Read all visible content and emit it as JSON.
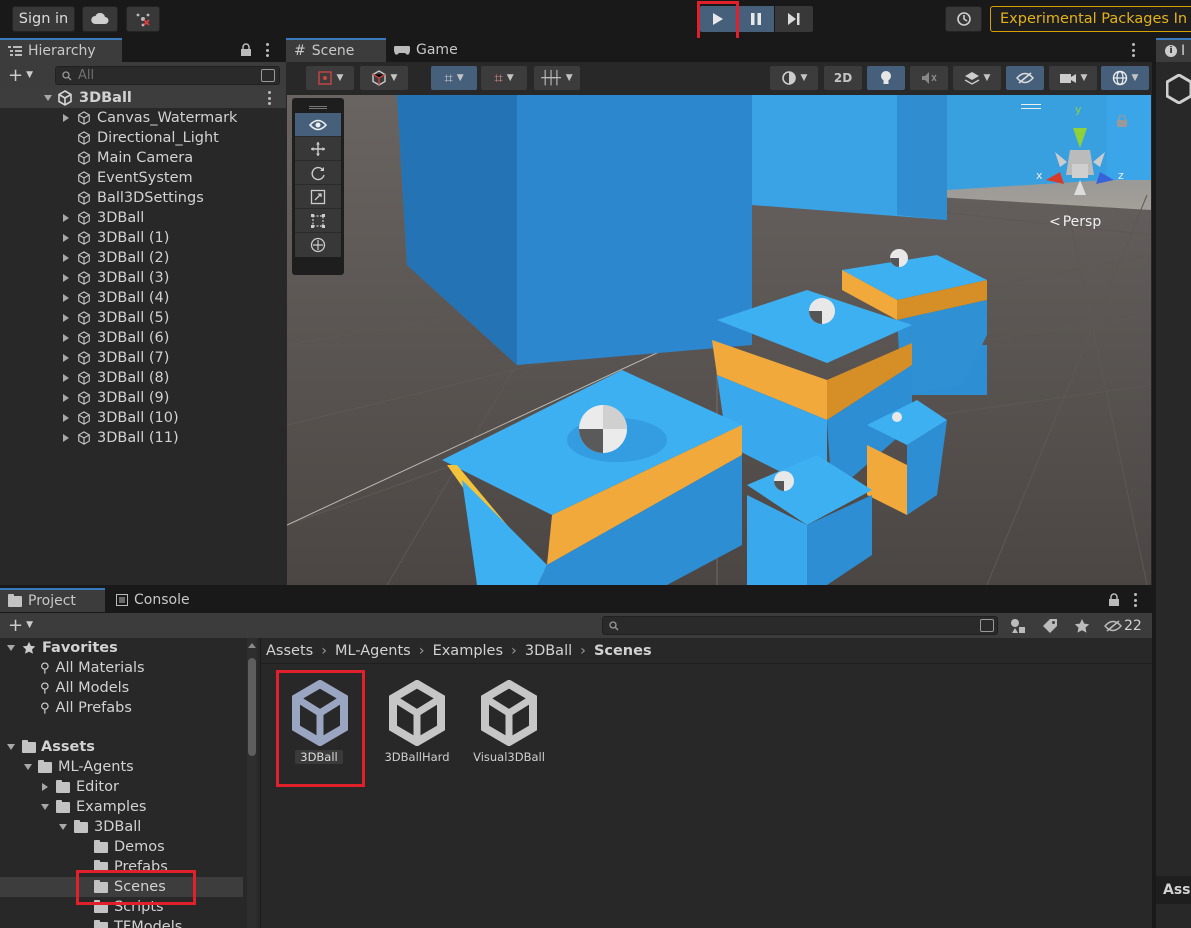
{
  "toolbar": {
    "sign_in": "Sign in",
    "experimental": "Experimental Packages In U"
  },
  "hierarchy": {
    "tab": "Hierarchy",
    "search_placeholder": "All",
    "root": "3DBall",
    "items": [
      {
        "label": "Canvas_Watermark",
        "expandable": true
      },
      {
        "label": "Directional_Light",
        "expandable": false
      },
      {
        "label": "Main Camera",
        "expandable": false
      },
      {
        "label": "EventSystem",
        "expandable": false
      },
      {
        "label": "Ball3DSettings",
        "expandable": false
      },
      {
        "label": "3DBall",
        "expandable": true
      },
      {
        "label": "3DBall (1)",
        "expandable": true
      },
      {
        "label": "3DBall (2)",
        "expandable": true
      },
      {
        "label": "3DBall (3)",
        "expandable": true
      },
      {
        "label": "3DBall (4)",
        "expandable": true
      },
      {
        "label": "3DBall (5)",
        "expandable": true
      },
      {
        "label": "3DBall (6)",
        "expandable": true
      },
      {
        "label": "3DBall (7)",
        "expandable": true
      },
      {
        "label": "3DBall (8)",
        "expandable": true
      },
      {
        "label": "3DBall (9)",
        "expandable": true
      },
      {
        "label": "3DBall (10)",
        "expandable": true
      },
      {
        "label": "3DBall (11)",
        "expandable": true
      }
    ]
  },
  "scene": {
    "tab_scene": "Scene",
    "tab_game": "Game",
    "btn_2d": "2D",
    "persp": "Persp",
    "axis_x": "x",
    "axis_y": "y",
    "axis_z": "z"
  },
  "inspector": {
    "tab_partial": "I",
    "bottom_partial": "Ass"
  },
  "project": {
    "tab_project": "Project",
    "tab_console": "Console",
    "hidden_count": "22",
    "favorites": {
      "label": "Favorites",
      "items": [
        "All Materials",
        "All Models",
        "All Prefabs"
      ]
    },
    "assets_label": "Assets",
    "tree": {
      "ml_agents": "ML-Agents",
      "editor": "Editor",
      "examples": "Examples",
      "ball3d": "3DBall",
      "demos": "Demos",
      "prefabs": "Prefabs",
      "scenes": "Scenes",
      "scripts": "Scripts",
      "tfmodels": "TFModels"
    },
    "breadcrumb": [
      "Assets",
      "ML-Agents",
      "Examples",
      "3DBall",
      "Scenes"
    ],
    "files": [
      "3DBall",
      "3DBallHard",
      "Visual3DBall"
    ]
  },
  "colors": {
    "accent": "#3a79bb",
    "highlight": "#e0202a",
    "platform_blue": "#3db0f2",
    "platform_orange": "#f2a93b",
    "experimental_border": "#d6a100"
  }
}
